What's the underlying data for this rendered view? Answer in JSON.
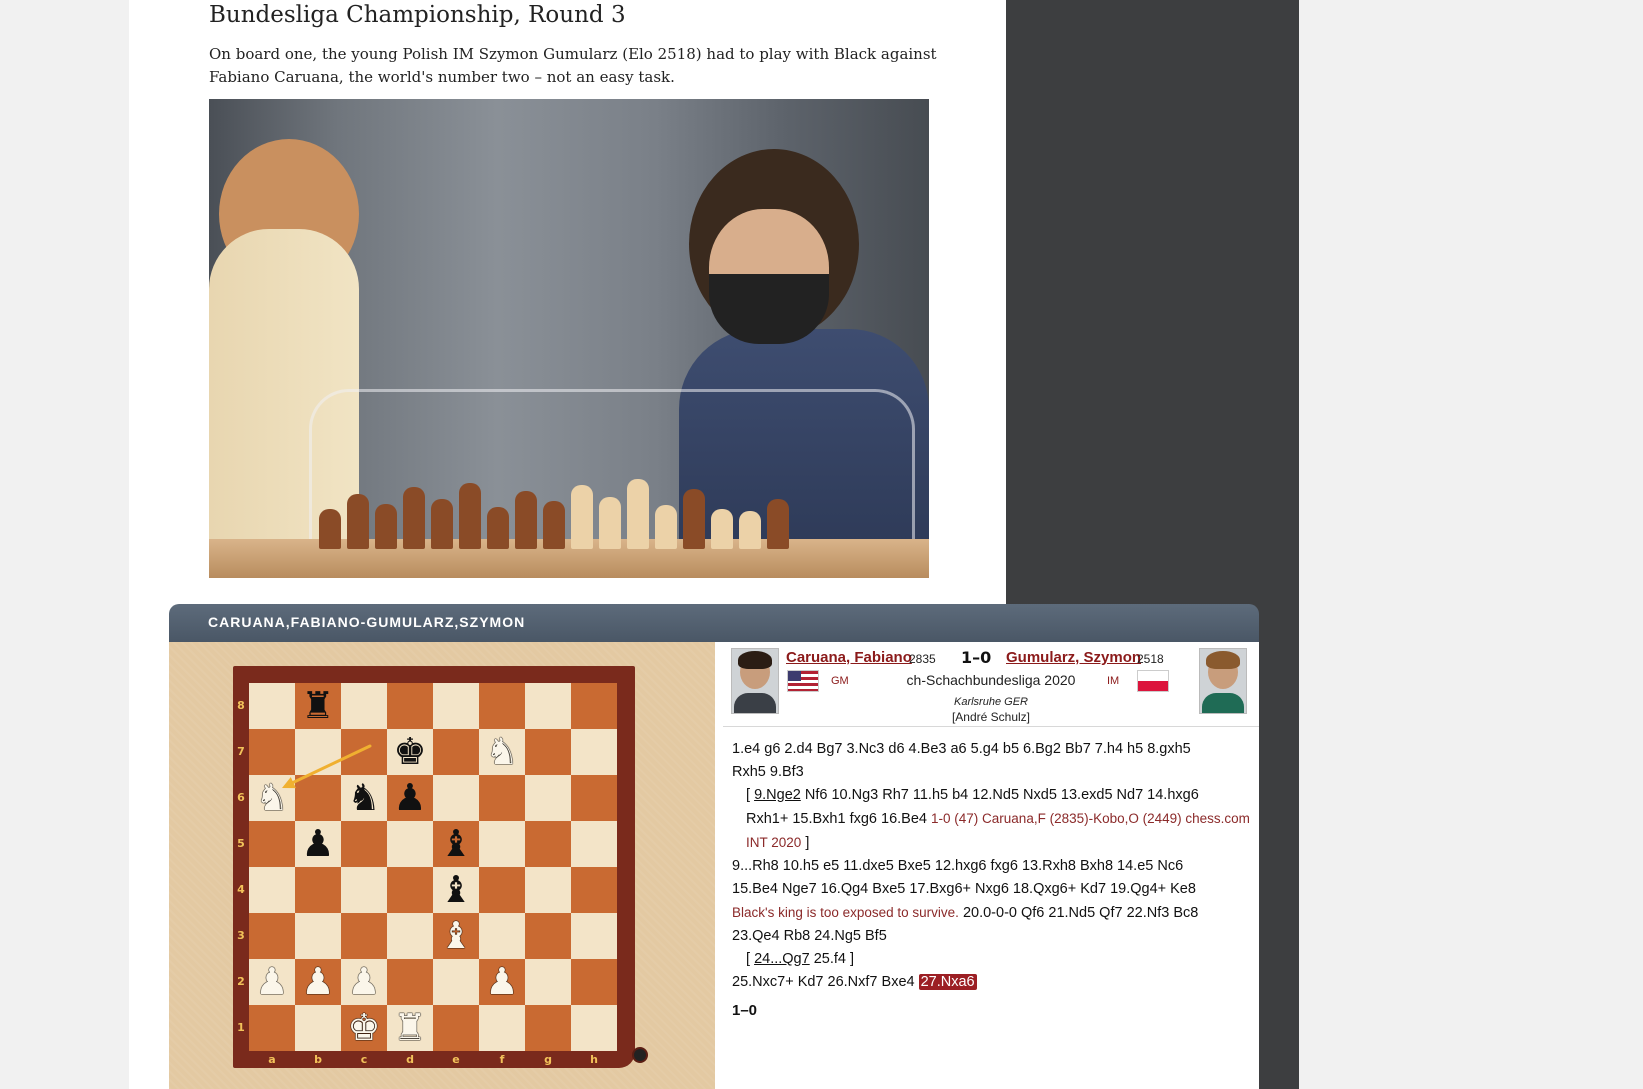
{
  "article": {
    "headline": "Bundesliga Championship, Round 3",
    "lede": "On board one, the young Polish IM Szymon Gumularz (Elo 2518) had to play with Black against Fabiano Caruana, the world's number two – not an easy task."
  },
  "widget": {
    "title": "CARUANA,FABIANO-GUMULARZ,SZYMON",
    "files": [
      "a",
      "b",
      "c",
      "d",
      "e",
      "f",
      "g",
      "h"
    ],
    "ranks": [
      "8",
      "7",
      "6",
      "5",
      "4",
      "3",
      "2",
      "1"
    ],
    "pieces": [
      {
        "sq": "b8",
        "glyph": "♜",
        "color": "black"
      },
      {
        "sq": "d7",
        "glyph": "♚",
        "color": "black"
      },
      {
        "sq": "f7",
        "glyph": "♞",
        "color": "white"
      },
      {
        "sq": "a6",
        "glyph": "♞",
        "color": "white"
      },
      {
        "sq": "c6",
        "glyph": "♞",
        "color": "black"
      },
      {
        "sq": "d6",
        "glyph": "♟",
        "color": "black"
      },
      {
        "sq": "b5",
        "glyph": "♟",
        "color": "black"
      },
      {
        "sq": "e5",
        "glyph": "♝",
        "color": "black"
      },
      {
        "sq": "e4",
        "glyph": "♝",
        "color": "black"
      },
      {
        "sq": "e3",
        "glyph": "♝",
        "color": "white"
      },
      {
        "sq": "a2",
        "glyph": "♟",
        "color": "white"
      },
      {
        "sq": "b2",
        "glyph": "♟",
        "color": "white"
      },
      {
        "sq": "c2",
        "glyph": "♟",
        "color": "white"
      },
      {
        "sq": "f2",
        "glyph": "♟",
        "color": "white"
      },
      {
        "sq": "c1",
        "glyph": "♚",
        "color": "white"
      },
      {
        "sq": "d1",
        "glyph": "♜",
        "color": "white"
      }
    ],
    "last_move": {
      "from": "c7",
      "to": "a6",
      "color": "#f0b030"
    },
    "game": {
      "white_name": "Caruana, Fabiano",
      "white_elo": "2835",
      "white_title": "GM",
      "result": "1–0",
      "black_name": "Gumularz, Szymon",
      "black_elo": "2518",
      "black_title": "IM",
      "event": "ch-Schachbundesliga 2020",
      "site": "Karlsruhe GER",
      "annotator": "[André Schulz]"
    },
    "moves": {
      "l1": "1.e4 g6 2.d4 Bg7 3.Nc3 d6 4.Be3 a6 5.g4 b5 6.Bg2 Bb7 7.h4 h5 8.gxh5",
      "l2": "Rxh5 9.Bf3",
      "v1_open": "[ ",
      "v1_link": "9.Nge2",
      "v1_rest": " Nf6 10.Ng3 Rh7 11.h5 b4 12.Nd5 Nxd5 13.exd5 Nd7 14.hxg6",
      "v1_l2": "Rxh1+ 15.Bxh1 fxg6 16.Be4 ",
      "v1_ref": "1-0 (47) Caruana,F (2835)-Kobo,O (2449) chess.com",
      "v1_ref2": "INT 2020",
      "v1_close": " ]",
      "l3": "9...Rh8 10.h5 e5 11.dxe5 Bxe5 12.hxg6 fxg6 13.Rxh8 Bxh8 14.e5 Nc6",
      "l4": "15.Be4 Nge7 16.Qg4 Bxe5 17.Bxg6+ Nxg6 18.Qxg6+ Kd7 19.Qg4+ Ke8",
      "comment": "Black's king is too exposed to survive.",
      "l5_rest": "  20.0-0-0 Qf6 21.Nd5 Qf7 22.Nf3 Bc8",
      "l6": "23.Qe4 Rb8 24.Ng5 Bf5",
      "v2_open": "[ ",
      "v2_link": "24...Qg7",
      "v2_rest": " 25.f4 ]",
      "l7": "25.Nxc7+ Kd7 26.Nxf7 Bxe4 ",
      "current": "27.Nxa6",
      "final": "1–0"
    }
  }
}
